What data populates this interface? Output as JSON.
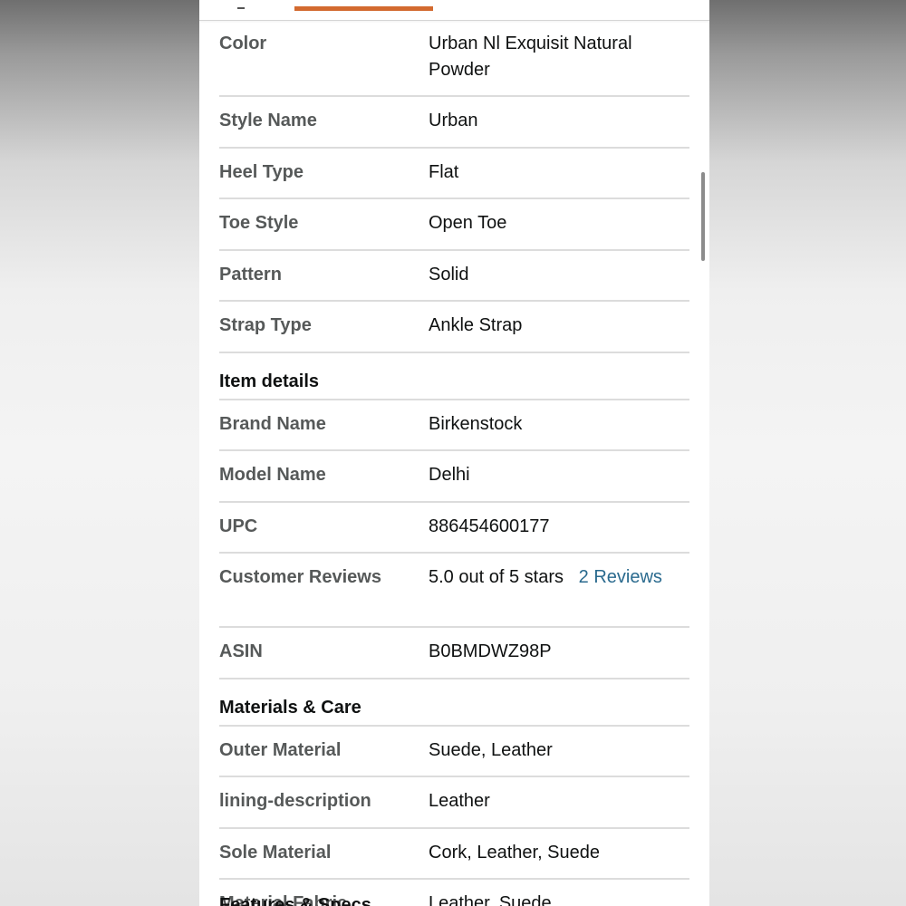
{
  "scrollbar": {
    "visible": true
  },
  "tabs": {
    "active_color": "#d36a2f"
  },
  "style_rows": [
    {
      "key": "Color",
      "value": "Urban Nl Exquisit Natural Powder"
    },
    {
      "key": "Style Name",
      "value": "Urban"
    },
    {
      "key": "Heel Type",
      "value": "Flat"
    },
    {
      "key": "Toe Style",
      "value": "Open Toe"
    },
    {
      "key": "Pattern",
      "value": "Solid"
    },
    {
      "key": "Strap Type",
      "value": "Ankle Strap"
    }
  ],
  "item_details": {
    "heading": "Item details",
    "rows": [
      {
        "key": "Brand Name",
        "value": "Birkenstock"
      },
      {
        "key": "Model Name",
        "value": "Delhi"
      },
      {
        "key": "UPC",
        "value": "886454600177"
      },
      {
        "key": "Customer Reviews",
        "value": "5.0 out of 5 stars",
        "link": "2 Reviews"
      },
      {
        "key": "ASIN",
        "value": "B0BMDWZ98P"
      }
    ]
  },
  "materials_care": {
    "heading": "Materials & Care",
    "rows": [
      {
        "key": "Outer Material",
        "value": "Suede, Leather"
      },
      {
        "key": "lining-description",
        "value": "Leather"
      },
      {
        "key": "Sole Material",
        "value": "Cork, Leather, Suede"
      },
      {
        "key": "Material Fabric",
        "value": "Leather, Suede"
      }
    ]
  },
  "next_section_heading": "Features & Specs"
}
